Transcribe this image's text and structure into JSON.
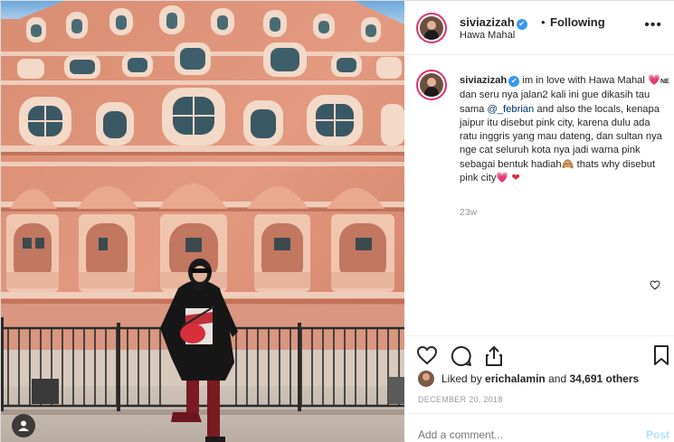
{
  "photo": {
    "tag_icon": "user-tag-icon"
  },
  "header": {
    "username": "siviazizah",
    "verified_icon": "✔",
    "separator": "•",
    "follow_status": "Following",
    "location": "Hawa Mahal",
    "more_icon": "•••"
  },
  "caption": {
    "username": "siviazizah",
    "text_1": "im in love with Hawa Mahal",
    "emoji_1": "💗",
    "ne": "NE",
    "text_2": "dan seru nya jalan2 kali ini gue dikasih tau sama",
    "mention": "@_febrian",
    "text_3": "and also the locals, kenapa jaipur itu disebut pink city, karena dulu ada ratu inggris yang mau dateng, dan sultan nya nge cat seluruh kota nya jadi warna pink sebagai bentuk hadiah",
    "emoji_2": "🙈",
    "text_4": "thats why disebut pink city",
    "emoji_3": "💗",
    "emoji_4": "❤",
    "time_ago": "23w"
  },
  "actions": {
    "like_icon": "heart-icon",
    "comment_icon": "comment-icon",
    "share_icon": "share-icon",
    "save_icon": "bookmark-icon"
  },
  "likes": {
    "prefix": "Liked by",
    "user": "erichalamin",
    "middle": "and",
    "count": "34,691 others"
  },
  "date": "DECEMBER 20, 2018",
  "comment_box": {
    "placeholder": "Add a comment...",
    "post_label": "Post"
  },
  "colors": {
    "accent_link": "#003569",
    "verified": "#3897f0",
    "heart": "#d62f3b",
    "post_disabled": "#b2dffc"
  }
}
